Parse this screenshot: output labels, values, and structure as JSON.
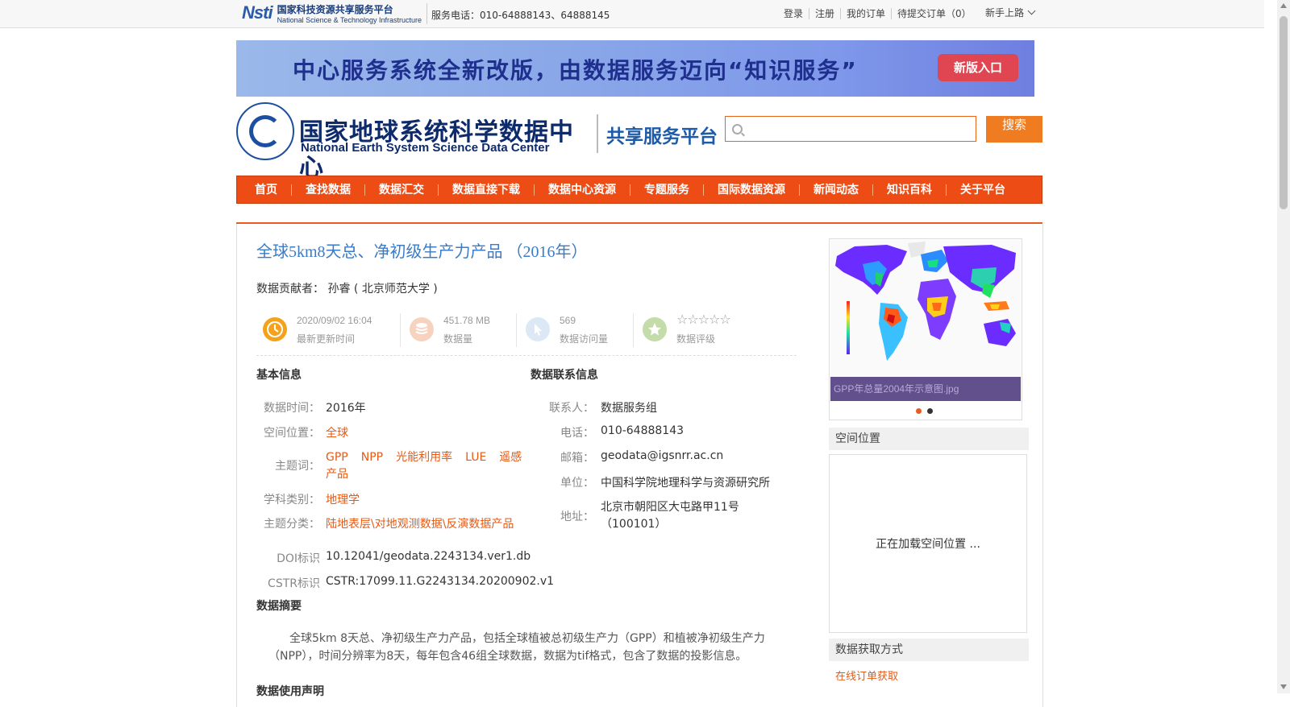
{
  "topbar": {
    "logo_mark": "Nsti",
    "logo_cn": "国家科技资源共享服务平台",
    "logo_en": "National Science & Technology Infrastructure",
    "phone": "服务电话：010-64888143、64888145",
    "links": [
      "登录",
      "注册",
      "我的订单",
      "待提交订单（0）"
    ],
    "guide": "新手上路"
  },
  "banner": {
    "text": "中心服务系统全新改版，由数据服务迈向“知识服务”",
    "button": "新版入口"
  },
  "header": {
    "center_cn": "国家地球系统科学数据中心",
    "center_en": "National Earth System Science Data Center",
    "platform": "共享服务平台",
    "search_placeholder": "",
    "search_button": "搜索"
  },
  "nav": {
    "items": [
      "首页",
      "查找数据",
      "数据汇交",
      "数据直接下载",
      "数据中心资源",
      "专题服务",
      "国际数据资源",
      "新闻动态",
      "知识百科",
      "关于平台"
    ]
  },
  "dataset": {
    "title": "全球5km8天总、净初级生产力产品 （2016年）",
    "contributor_label": "数据贡献者：",
    "contributor": "孙睿 ( 北京师范大学 )",
    "stats": {
      "updated": {
        "value": "2020/09/02 16:04",
        "label": "最新更新时间"
      },
      "size": {
        "value": "451.78 MB",
        "label": "数据量"
      },
      "visits": {
        "value": "569",
        "label": "数据访问量"
      },
      "rating": {
        "stars": 0,
        "max": 5,
        "label": "数据评级"
      }
    }
  },
  "basic_info": {
    "heading": "基本信息",
    "time_label": "数据时间：",
    "time": "2016年",
    "space_label": "空间位置：",
    "space": "全球",
    "keywords_label": "主题词：",
    "keywords": [
      "GPP",
      "NPP",
      "光能利用率",
      "LUE",
      "遥感产品"
    ],
    "discipline_label": "学科类别：",
    "discipline": "地理学",
    "category_label": "主题分类：",
    "category": "陆地表层\\对地观测数据\\反演数据产品",
    "doi_label": "DOI标识",
    "doi": "10.12041/geodata.2243134.ver1.db",
    "cstr_label": "CSTR标识",
    "cstr": "CSTR:17099.11.G2243134.20200902.v1"
  },
  "contact_info": {
    "heading": "数据联系信息",
    "person_label": "联系人：",
    "person": "数据服务组",
    "phone_label": "电话：",
    "phone": "010-64888143",
    "email_label": "邮箱：",
    "email": "geodata@igsnrr.ac.cn",
    "unit_label": "单位：",
    "unit": "中国科学院地理科学与资源研究所",
    "address_label": "地址：",
    "address": "北京市朝阳区大屯路甲11号（100101）"
  },
  "abstract": {
    "heading": "数据摘要",
    "text": "全球5km 8天总、净初级生产力产品，包括全球植被总初级生产力（GPP）和植被净初级生产力（NPP），时间分辨率为8天，每年包含46组全球数据，数据为tif格式，包含了数据的投影信息。"
  },
  "usage": {
    "heading": "数据使用声明"
  },
  "sidebar": {
    "map_caption": "GPP年总量2004年示意图.jpg",
    "spatial_heading": "空间位置",
    "spatial_loading": "正在加载空间位置 ...",
    "access_heading": "数据获取方式",
    "access_link": "在线订单获取"
  },
  "colors": {
    "accent": "#ed4c15",
    "link": "#e65a14",
    "title": "#3a7bc8"
  }
}
